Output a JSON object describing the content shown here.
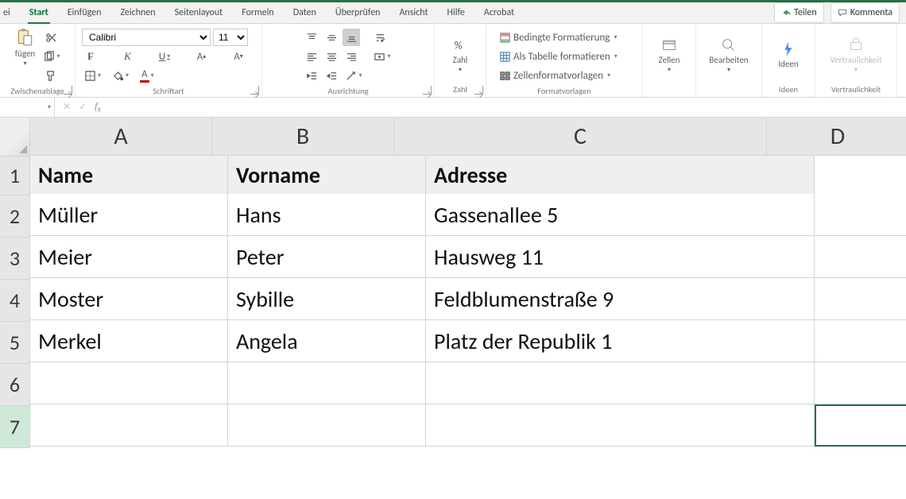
{
  "ribbon": {
    "file": "ei",
    "tabs": [
      "Start",
      "Einfügen",
      "Zeichnen",
      "Seitenlayout",
      "Formeln",
      "Daten",
      "Überprüfen",
      "Ansicht",
      "Hilfe",
      "Acrobat"
    ],
    "active_tab": "Start",
    "share": "Teilen",
    "comment": "Kommenta"
  },
  "groups": {
    "clipboard": {
      "paste": "fügen",
      "label": "Zwischenablage"
    },
    "font": {
      "name": "Calibri",
      "size": "11",
      "label": "Schriftart"
    },
    "align": {
      "label": "Ausrichtung"
    },
    "number": {
      "label": "Zahl",
      "btn": "Zahl"
    },
    "styles": {
      "cond": "Bedingte Formatierung",
      "table": "Als Tabelle formatieren",
      "cell": "Zellenformatvorlagen",
      "label": "Formatvorlagen"
    },
    "cells": {
      "btn": "Zellen"
    },
    "editing": {
      "btn": "Bearbeiten"
    },
    "ideas": {
      "btn": "Ideen",
      "label": "Ideen"
    },
    "sensitivity": {
      "btn": "Vertraulichkeit",
      "label": "Vertraulichkeit"
    }
  },
  "namebox": "",
  "sheet": {
    "columns": [
      "A",
      "B",
      "C",
      "D"
    ],
    "rows": [
      "1",
      "2",
      "3",
      "4",
      "5",
      "6",
      "7"
    ],
    "active_row": "7",
    "headers": {
      "A": "Name",
      "B": "Vorname",
      "C": "Adresse"
    },
    "data": [
      {
        "A": "Müller",
        "B": "Hans",
        "C": "Gassenallee 5"
      },
      {
        "A": "Meier",
        "B": "Peter",
        "C": "Hausweg 11"
      },
      {
        "A": "Moster",
        "B": "Sybille",
        "C": "Feldblumenstraße 9"
      },
      {
        "A": "Merkel",
        "B": "Angela",
        "C": "Platz der Republik 1"
      }
    ],
    "selected": "D7"
  },
  "chart_data": {
    "type": "table",
    "columns": [
      "Name",
      "Vorname",
      "Adresse"
    ],
    "rows": [
      [
        "Müller",
        "Hans",
        "Gassenallee 5"
      ],
      [
        "Meier",
        "Peter",
        "Hausweg 11"
      ],
      [
        "Moster",
        "Sybille",
        "Feldblumenstraße 9"
      ],
      [
        "Merkel",
        "Angela",
        "Platz der Republik 1"
      ]
    ]
  }
}
